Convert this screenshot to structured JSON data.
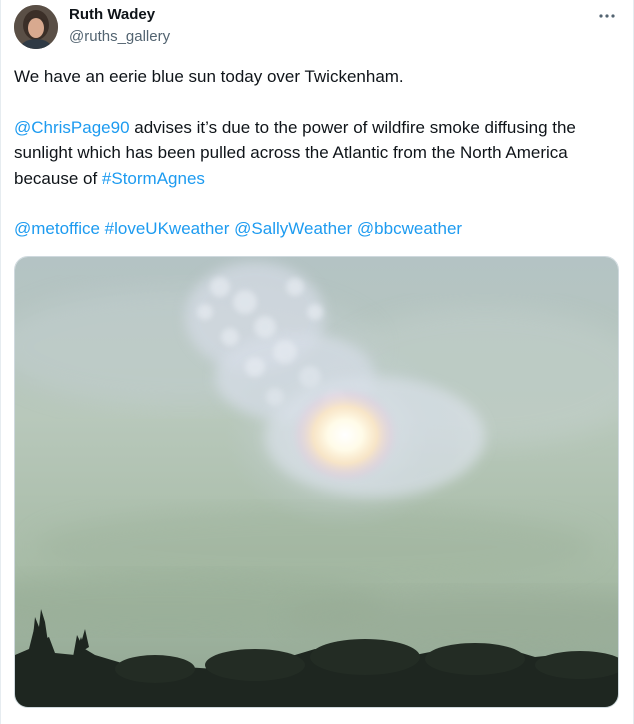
{
  "author": {
    "display_name": "Ruth Wadey",
    "handle": "@ruths_gallery",
    "avatar_icon": "profile-photo"
  },
  "menu": {
    "more_icon": "more-horizontal-icon"
  },
  "tweet": {
    "line1": "We have an eerie blue sun today over Twickenham.",
    "mention_chrispage": "@ChrisPage90",
    "line2_text": " advises it’s due to the power of wildfire smoke diffusing the sunlight which has been pulled across the Atlantic from the North America because of ",
    "hashtag_stormagnes": "#StormAgnes",
    "tag_metoffice": "@metoffice",
    "tag_loveukweather": "#loveUKweather",
    "tag_sallyweather": "@SallyWeather",
    "tag_bbcweather": "@bbcweather"
  },
  "colors": {
    "link": "#1d9bf0",
    "text": "#0f1419",
    "secondary": "#536471",
    "sky": "#a9bfae"
  }
}
